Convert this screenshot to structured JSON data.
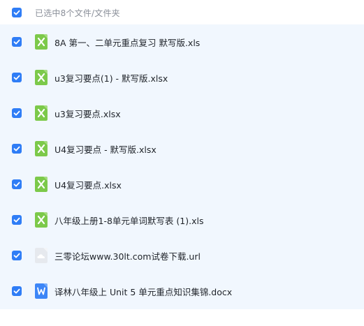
{
  "header": {
    "label": "已选中8个文件/文件夹",
    "checked": true
  },
  "files": [
    {
      "name": "8A 第一、二单元重点复习 默写版.xls",
      "icon": "excel-icon",
      "checked": true
    },
    {
      "name": "u3复习要点(1) - 默写版.xlsx",
      "icon": "excel-icon",
      "checked": true
    },
    {
      "name": "u3复习要点.xlsx",
      "icon": "excel-icon",
      "checked": true
    },
    {
      "name": "U4复习要点 - 默写版.xlsx",
      "icon": "excel-icon",
      "checked": true
    },
    {
      "name": "U4复习要点.xlsx",
      "icon": "excel-icon",
      "checked": true
    },
    {
      "name": "八年级上册1-8单元单词默写表 (1).xls",
      "icon": "excel-icon",
      "checked": true
    },
    {
      "name": "三零论坛www.30lt.com试卷下载.url",
      "icon": "url-cloud-icon",
      "checked": true
    },
    {
      "name": "译林八年级上 Unit 5 单元重点知识集锦.docx",
      "icon": "word-icon",
      "checked": true
    }
  ],
  "colors": {
    "accent": "#2f7df6",
    "list_background": "#f1f7fe",
    "excel": "#7cc94a",
    "word": "#3d86f7",
    "url": "#dfe3e8"
  }
}
